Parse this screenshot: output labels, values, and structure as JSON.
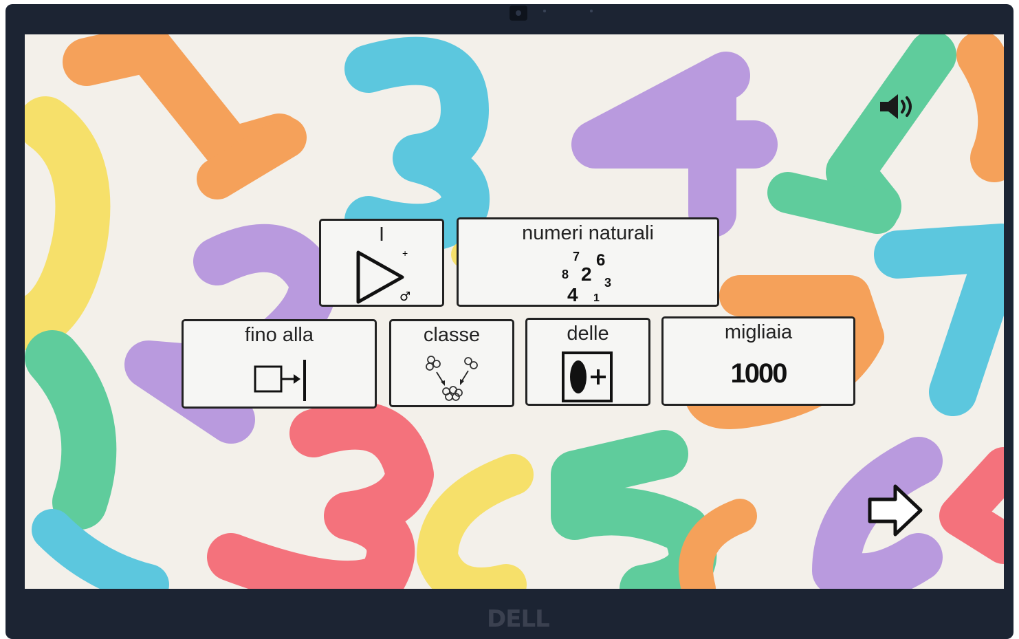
{
  "device": {
    "brand": "DELL"
  },
  "toolbar": {
    "speaker_icon": "speaker-icon",
    "next_icon": "right-arrow-icon"
  },
  "cards": {
    "article": {
      "label": "I",
      "symbol_marks": [
        "+",
        "♂"
      ]
    },
    "natural_numbers": {
      "label": "numeri naturali",
      "digits": [
        "7",
        "6",
        "8",
        "2",
        "3",
        "4",
        "1"
      ]
    },
    "up_to": {
      "label": "fino alla"
    },
    "class": {
      "label": "classe"
    },
    "of_the": {
      "label": "delle"
    },
    "thousands": {
      "label": "migliaia",
      "value": "1000"
    }
  },
  "colors": {
    "card_border": "#222222",
    "card_fill": "#f6f6f4",
    "bezel": "#1c2433"
  }
}
